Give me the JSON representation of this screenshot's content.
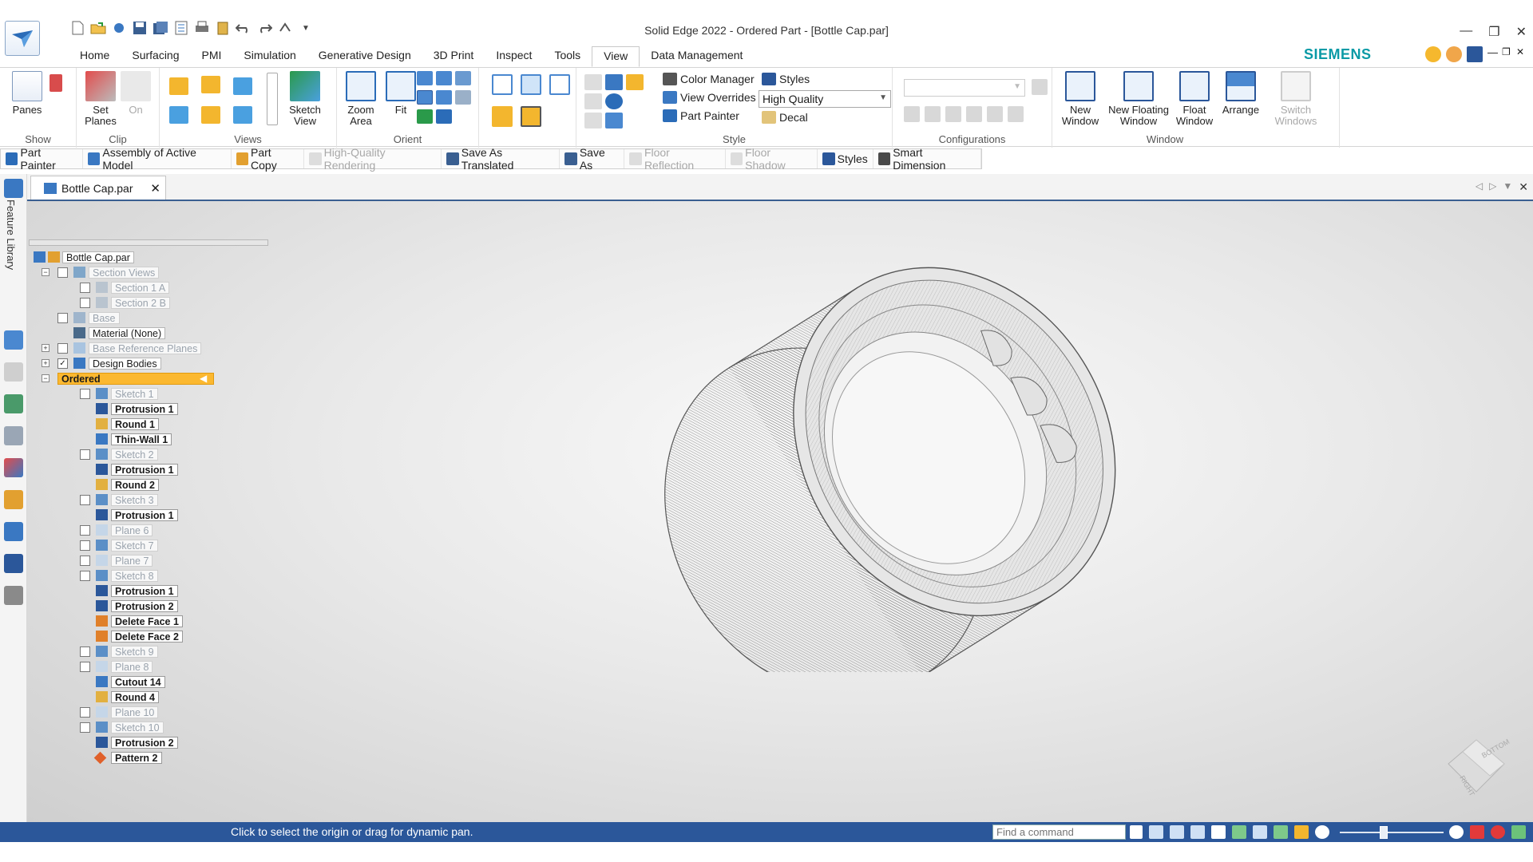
{
  "window": {
    "title": "Solid Edge 2022 - Ordered Part - [Bottle Cap.par]",
    "brand": "SIEMENS"
  },
  "tabs": [
    "Home",
    "Surfacing",
    "PMI",
    "Simulation",
    "Generative Design",
    "3D Print",
    "Inspect",
    "Tools",
    "View",
    "Data Management"
  ],
  "active_tab": "View",
  "ribbon": {
    "show": {
      "label": "Show",
      "panes": "Panes"
    },
    "clip": {
      "label": "Clip",
      "set_planes": "Set Planes",
      "on": "On"
    },
    "views": {
      "label": "Views",
      "sketch_view": "Sketch View"
    },
    "orient": {
      "label": "Orient",
      "zoom_area": "Zoom Area",
      "fit": "Fit"
    },
    "style": {
      "label": "Style",
      "color_manager": "Color Manager",
      "styles": "Styles",
      "view_overrides": "View Overrides",
      "view_overrides_value": "High Quality",
      "part_painter": "Part Painter",
      "decal": "Decal"
    },
    "configurations": {
      "label": "Configurations"
    },
    "window": {
      "label": "Window",
      "new_window": "New Window",
      "new_floating_window": "New Floating Window",
      "float_window": "Float Window",
      "arrange": "Arrange",
      "switch_windows": "Switch Windows"
    }
  },
  "command_bar": [
    "Part Painter",
    "Assembly of Active Model",
    "Part Copy",
    "High-Quality Rendering",
    "Save As Translated",
    "Save As",
    "Floor Reflection",
    "Floor Shadow",
    "Styles",
    "Smart Dimension"
  ],
  "left_strip": {
    "feature_library": "Feature Library"
  },
  "document_tab": "Bottle Cap.par",
  "tree": {
    "root": "Bottle Cap.par",
    "section_views": "Section Views",
    "section_1a": "Section 1 A",
    "section_2b": "Section 2 B",
    "base": "Base",
    "material": "Material (None)",
    "base_ref_planes": "Base Reference Planes",
    "design_bodies": "Design Bodies",
    "ordered": "Ordered",
    "features": [
      "Sketch 1",
      "Protrusion 1",
      "Round 1",
      "Thin-Wall 1",
      "Sketch 2",
      "Protrusion 1",
      "Round 2",
      "Sketch 3",
      "Protrusion 1",
      "Plane 6",
      "Sketch 7",
      "Plane 7",
      "Sketch 8",
      "Protrusion 1",
      "Protrusion 2",
      "Delete Face 1",
      "Delete Face 2",
      "Sketch 9",
      "Plane 8",
      "Cutout 14",
      "Round 4",
      "Plane 10",
      "Sketch 10",
      "Protrusion 2",
      "Pattern 2"
    ]
  },
  "navcube": {
    "face1": "BOTTOM",
    "face2": "RIGHT"
  },
  "status": {
    "message": "Click to select the origin or drag for dynamic pan.",
    "find_placeholder": "Find a command"
  },
  "colors": {
    "accent": "#2b579a",
    "ordered_highlight": "#fbb830",
    "brand": "#0a9aa6"
  }
}
